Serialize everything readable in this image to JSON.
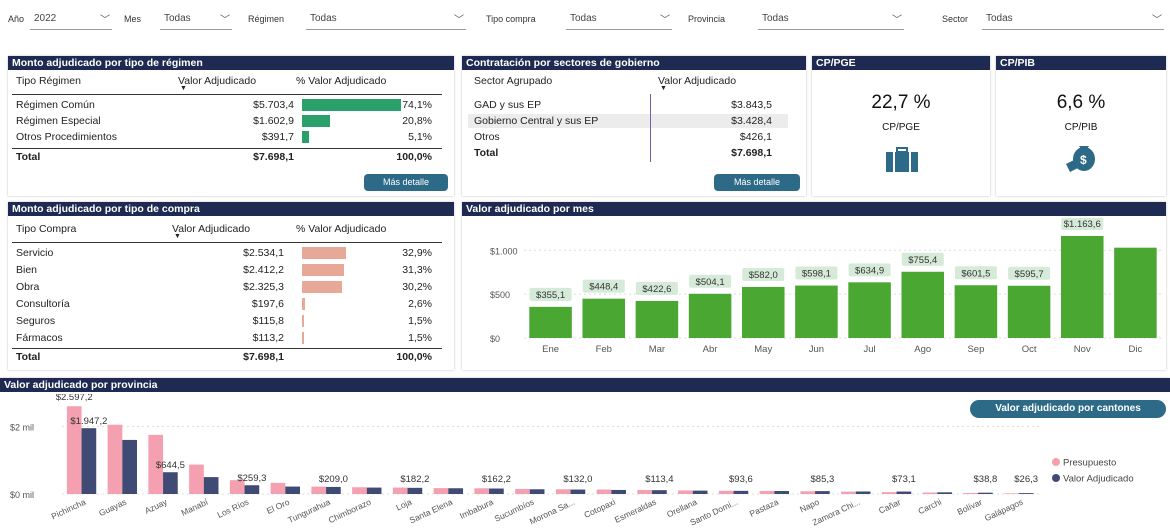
{
  "filters": {
    "year_label": "Año",
    "year_value": "2022",
    "month_label": "Mes",
    "month_value": "Todas",
    "regime_label": "Régimen",
    "regime_value": "Todas",
    "purchase_label": "Tipo compra",
    "purchase_value": "Todas",
    "province_label": "Provincia",
    "province_value": "Todas",
    "sector_label": "Sector",
    "sector_value": "Todas"
  },
  "regimen_panel": {
    "title": "Monto adjudicado por tipo de régimen",
    "col1": "Tipo Régimen",
    "col2": "Valor Adjudicado",
    "col3": "% Valor Adjudicado",
    "rows": [
      {
        "name": "Régimen Común",
        "value": "$5.703,4",
        "pct": "74,1%",
        "frac": 0.741
      },
      {
        "name": "Régimen Especial",
        "value": "$1.602,9",
        "pct": "20,8%",
        "frac": 0.208
      },
      {
        "name": "Otros Procedimientos",
        "value": "$391,7",
        "pct": "5,1%",
        "frac": 0.051
      }
    ],
    "total_label": "Total",
    "total_value": "$7.698,1",
    "total_pct": "100,0%",
    "button": "Más detalle",
    "bar_color": "#2aa06b"
  },
  "sector_panel": {
    "title": "Contratación por sectores de gobierno",
    "col1": "Sector Agrupado",
    "col2": "Valor Adjudicado",
    "rows": [
      {
        "name": "GAD y sus EP",
        "value": "$3.843,5"
      },
      {
        "name": "Gobierno Central y sus EP",
        "value": "$3.428,4"
      },
      {
        "name": "Otros",
        "value": "$426,1"
      }
    ],
    "total_label": "Total",
    "total_value": "$7.698,1",
    "button": "Más detalle"
  },
  "kpi_pge": {
    "title": "CP/PGE",
    "value": "22,7 %",
    "label": "CP/PGE",
    "icon": "briefcase-icon"
  },
  "kpi_pib": {
    "title": "CP/PIB",
    "value": "6,6 %",
    "label": "CP/PIB",
    "icon": "money-bag-icon"
  },
  "compra_panel": {
    "title": "Monto adjudicado por tipo de compra",
    "col1": "Tipo Compra",
    "col2": "Valor Adjudicado",
    "col3": "% Valor Adjudicado",
    "rows": [
      {
        "name": "Servicio",
        "value": "$2.534,1",
        "pct": "32,9%",
        "frac": 0.329
      },
      {
        "name": "Bien",
        "value": "$2.412,2",
        "pct": "31,3%",
        "frac": 0.313
      },
      {
        "name": "Obra",
        "value": "$2.325,3",
        "pct": "30,2%",
        "frac": 0.302
      },
      {
        "name": "Consultoría",
        "value": "$197,6",
        "pct": "2,6%",
        "frac": 0.026
      },
      {
        "name": "Seguros",
        "value": "$115,8",
        "pct": "1,5%",
        "frac": 0.015
      },
      {
        "name": "Fármacos",
        "value": "$113,2",
        "pct": "1,5%",
        "frac": 0.015
      }
    ],
    "total_label": "Total",
    "total_value": "$7.698,1",
    "total_pct": "100,0%",
    "bar_color": "#e8a898"
  },
  "month_panel": {
    "title": "Valor adjudicado por mes"
  },
  "province_panel": {
    "title": "Valor adjudicado por provincia",
    "button": "Valor adjudicado por cantones"
  },
  "chart_data": [
    {
      "type": "bar",
      "title": "Valor adjudicado por mes",
      "categories": [
        "Ene",
        "Feb",
        "Mar",
        "Abr",
        "May",
        "Jun",
        "Jul",
        "Ago",
        "Sep",
        "Oct",
        "Nov",
        "Dic"
      ],
      "values": [
        355.1,
        448.4,
        422.6,
        504.1,
        582.0,
        598.1,
        634.9,
        755.4,
        601.5,
        595.7,
        1163.6,
        1030
      ],
      "data_labels": [
        "$355,1",
        "$448,4",
        "$422,6",
        "$504,1",
        "$582,0",
        "$598,1",
        "$634,9",
        "$755,4",
        "$601,5",
        "$595,7",
        "$1.163,6",
        ""
      ],
      "yticks": [
        {
          "v": 0,
          "label": "$0"
        },
        {
          "v": 500,
          "label": "$500"
        },
        {
          "v": 1000,
          "label": "$1.000"
        }
      ],
      "ylim": [
        0,
        1300
      ],
      "color": "#4aa832"
    },
    {
      "type": "bar",
      "title": "Valor adjudicado por provincia",
      "categories": [
        "Pichincha",
        "Guayas",
        "Azuay",
        "Manabí",
        "Los Ríos",
        "El Oro",
        "Tungurahua",
        "Chimborazo",
        "Loja",
        "Santa Elena",
        "Imbabura",
        "Sucumbíos",
        "Morona Sa...",
        "Cotopaxi",
        "Esmeraldas",
        "Orellana",
        "Santo Domi...",
        "Pastaza",
        "Napo",
        "Zamora Chi...",
        "Cañar",
        "Carchi",
        "Bolívar",
        "Galápagos"
      ],
      "series": [
        {
          "name": "Presupuesto",
          "color": "#f4a0b0",
          "values": [
            2597.2,
            2050,
            1750,
            870,
            410,
            330,
            220,
            200,
            190,
            175,
            170,
            150,
            140,
            132,
            120,
            105,
            95,
            90,
            82,
            70,
            55,
            45,
            30,
            20
          ]
        },
        {
          "name": "Valor Adjudicado",
          "color": "#3f4a75",
          "values": [
            1947.2,
            1600,
            644.5,
            500,
            259.3,
            220,
            209.0,
            190,
            182.2,
            170,
            162.2,
            140,
            132.0,
            120,
            113.4,
            100,
            93.6,
            88,
            85.3,
            75,
            73.1,
            50,
            38.8,
            26.3
          ]
        }
      ],
      "data_labels": [
        {
          "i": 0,
          "s": 0,
          "label": "$2.597,2"
        },
        {
          "i": 0,
          "s": 1,
          "label": "$1.947,2"
        },
        {
          "i": 2,
          "s": 1,
          "label": "$644,5"
        },
        {
          "i": 4,
          "s": 1,
          "label": "$259,3"
        },
        {
          "i": 6,
          "s": 1,
          "label": "$209,0"
        },
        {
          "i": 8,
          "s": 1,
          "label": "$182,2"
        },
        {
          "i": 10,
          "s": 1,
          "label": "$162,2"
        },
        {
          "i": 12,
          "s": 1,
          "label": "$132,0"
        },
        {
          "i": 14,
          "s": 1,
          "label": "$113,4"
        },
        {
          "i": 16,
          "s": 1,
          "label": "$93,6"
        },
        {
          "i": 18,
          "s": 1,
          "label": "$85,3"
        },
        {
          "i": 20,
          "s": 1,
          "label": "$73,1"
        },
        {
          "i": 22,
          "s": 1,
          "label": "$38,8"
        },
        {
          "i": 23,
          "s": 1,
          "label": "$26,3"
        }
      ],
      "yticks": [
        {
          "v": 0,
          "label": "$0 mil"
        },
        {
          "v": 2000,
          "label": "$2 mil"
        }
      ],
      "ylim": [
        0,
        2900
      ],
      "legend": "right"
    }
  ]
}
